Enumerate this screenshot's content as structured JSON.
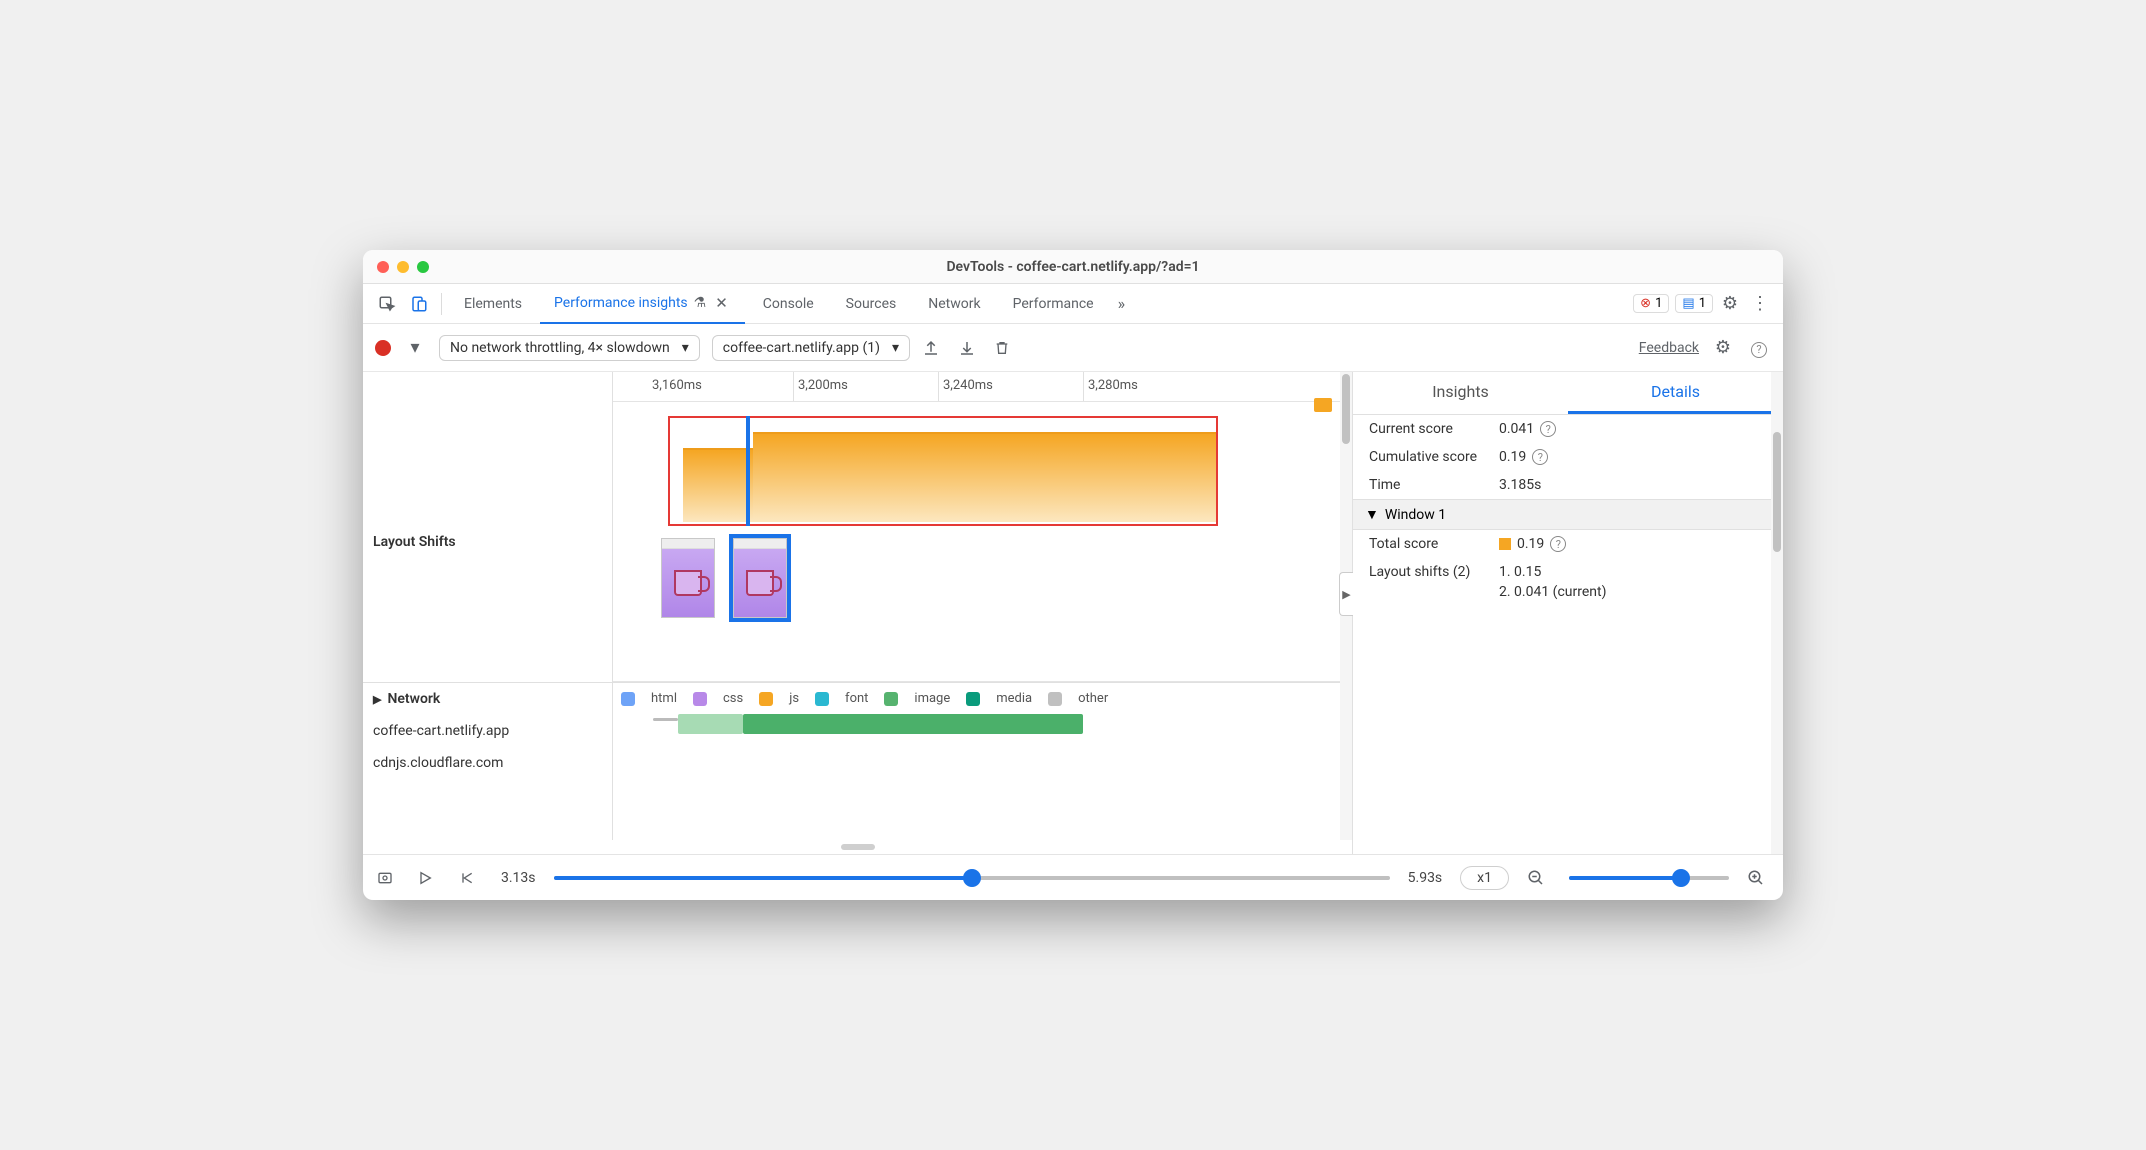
{
  "window": {
    "title": "DevTools - coffee-cart.netlify.app/?ad=1"
  },
  "tabs": {
    "elements": "Elements",
    "perf_insights": "Performance insights",
    "console": "Console",
    "sources": "Sources",
    "network": "Network",
    "performance": "Performance"
  },
  "badges": {
    "errors": "1",
    "messages": "1"
  },
  "toolbar": {
    "throttle": "No network throttling, 4× slowdown",
    "captured": "coffee-cart.netlify.app (1)",
    "feedback": "Feedback"
  },
  "ruler": {
    "t0": "3,160ms",
    "t1": "3,200ms",
    "t2": "3,240ms",
    "t3": "3,280ms"
  },
  "tracks": {
    "layout_shifts": "Layout Shifts",
    "network": "Network",
    "hosts": {
      "h0": "coffee-cart.netlify.app",
      "h1": "cdnjs.cloudflare.com"
    }
  },
  "legend": {
    "html": "html",
    "css": "css",
    "js": "js",
    "font": "font",
    "image": "image",
    "media": "media",
    "other": "other"
  },
  "footer": {
    "time_start": "3.13s",
    "time_end": "5.93s",
    "zoom": "x1"
  },
  "right": {
    "tabs": {
      "insights": "Insights",
      "details": "Details"
    },
    "current_score_k": "Current score",
    "current_score_v": "0.041",
    "cumulative_score_k": "Cumulative score",
    "cumulative_score_v": "0.19",
    "time_k": "Time",
    "time_v": "3.185s",
    "window_section": "Window 1",
    "total_score_k": "Total score",
    "total_score_v": "0.19",
    "ls_k": "Layout shifts (2)",
    "ls_1": "1. 0.15",
    "ls_2": "2. 0.041 (current)"
  },
  "colors": {
    "html": "#6ea3f7",
    "css": "#b889e8",
    "js": "#f5a623",
    "font": "#2ab8d1",
    "image": "#56b36f",
    "media": "#0a9b7c",
    "other": "#c0c0c0",
    "accent": "#1a73e8"
  }
}
